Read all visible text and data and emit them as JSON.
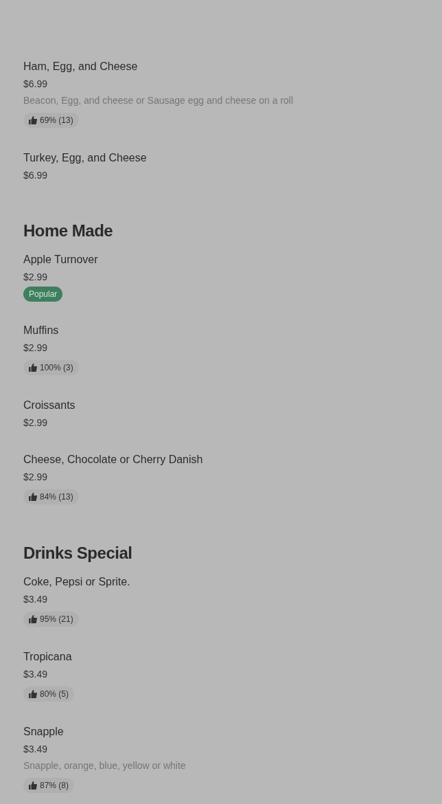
{
  "sections": [
    {
      "items": [
        {
          "name": "Ham, Egg, and Cheese",
          "price": "$6.99",
          "description": "Beacon, Egg, and cheese or Sausage egg and cheese on a roll",
          "badge": {
            "kind": "rating",
            "text": "69% (13)"
          }
        },
        {
          "name": "Turkey, Egg, and Cheese",
          "price": "$6.99"
        }
      ]
    },
    {
      "heading": "Home Made",
      "items": [
        {
          "name": "Apple Turnover",
          "price": "$2.99",
          "badge": {
            "kind": "popular",
            "text": "Popular"
          }
        },
        {
          "name": "Muffins",
          "price": "$2.99",
          "badge": {
            "kind": "rating",
            "text": "100% (3)"
          }
        },
        {
          "name": "Croissants",
          "price": "$2.99"
        },
        {
          "name": "Cheese, Chocolate or Cherry Danish",
          "price": "$2.99",
          "badge": {
            "kind": "rating",
            "text": "84% (13)"
          }
        }
      ]
    },
    {
      "heading": "Drinks Special",
      "items": [
        {
          "name": "Coke, Pepsi or Sprite.",
          "price": "$3.49",
          "badge": {
            "kind": "rating",
            "text": "95% (21)"
          }
        },
        {
          "name": "Tropicana",
          "price": "$3.49",
          "badge": {
            "kind": "rating",
            "text": "80% (5)"
          }
        },
        {
          "name": "Snapple",
          "price": "$3.49",
          "description": "Snapple, orange, blue, yellow or white",
          "badge": {
            "kind": "rating",
            "text": "87% (8)"
          }
        }
      ]
    }
  ]
}
